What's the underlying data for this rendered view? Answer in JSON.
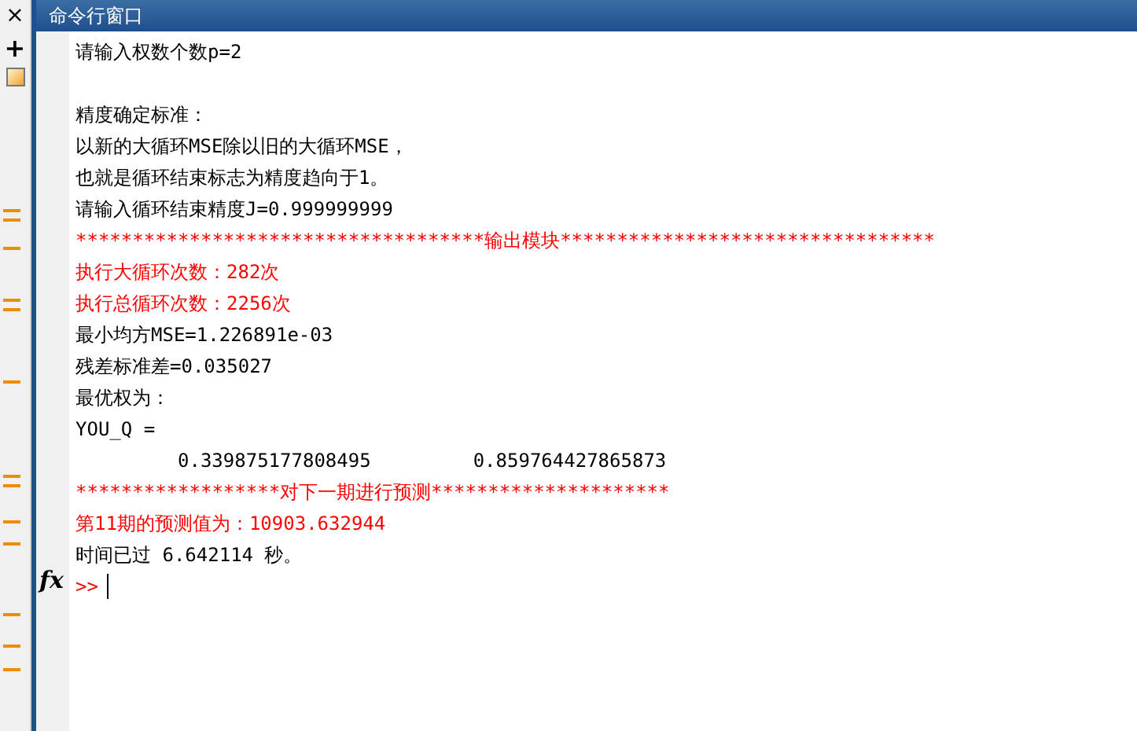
{
  "window": {
    "title": "命令行窗口",
    "close": "×",
    "add": "+"
  },
  "lines": [
    {
      "kind": "text",
      "text": "请输入权数个数p=2",
      "color": "#000000"
    },
    {
      "kind": "blank"
    },
    {
      "kind": "text",
      "text": "精度确定标准：",
      "color": "#000000"
    },
    {
      "kind": "text",
      "text": "以新的大循环MSE除以旧的大循环MSE，",
      "color": "#000000"
    },
    {
      "kind": "text",
      "text": "也就是循环结束标志为精度趋向于1。",
      "color": "#000000"
    },
    {
      "kind": "text",
      "text": "请输入循环结束精度J=0.999999999",
      "color": "#000000"
    },
    {
      "kind": "text",
      "text": "************************************输出模块*********************************",
      "color": "#ff0000"
    },
    {
      "kind": "text",
      "text": "执行大循环次数：282次",
      "color": "#ff0000"
    },
    {
      "kind": "text",
      "text": "执行总循环次数：2256次",
      "color": "#ff0000"
    },
    {
      "kind": "text",
      "text": "最小均方MSE=1.226891e-03",
      "color": "#000000"
    },
    {
      "kind": "text",
      "text": "残差标准差=0.035027",
      "color": "#000000"
    },
    {
      "kind": "text",
      "text": "最优权为：",
      "color": "#000000"
    },
    {
      "kind": "text",
      "text": "YOU_Q =",
      "color": "#000000"
    },
    {
      "kind": "values",
      "values": [
        "0.339875177808495",
        "0.859764427865873"
      ]
    },
    {
      "kind": "text",
      "text": "******************对下一期进行预测*********************",
      "color": "#ff0000"
    },
    {
      "kind": "text",
      "text": "第11期的预测值为：10903.632944",
      "color": "#ff0000"
    },
    {
      "kind": "text",
      "text": "时间已过 6.642114 秒。",
      "color": "#000000"
    }
  ],
  "prompt": {
    "function": "fx",
    "text": ">>"
  }
}
